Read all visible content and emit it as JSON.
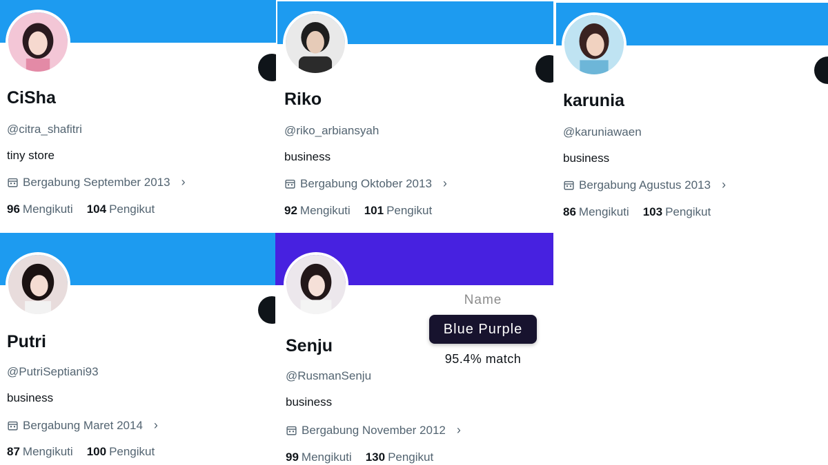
{
  "colors": {
    "twitter_blue": "#1d9bf0",
    "blue_purple": "#4721e0",
    "text": "#0f1419",
    "muted": "#536471"
  },
  "profiles": [
    {
      "name": "CiSha",
      "handle": "@citra_shafitri",
      "bio": "tiny store",
      "joined": "Bergabung September 2013",
      "following_count": "96",
      "following_label": "Mengikuti",
      "followers_count": "104",
      "followers_label": "Pengikut"
    },
    {
      "name": "Riko",
      "handle": "@riko_arbiansyah",
      "bio": "business",
      "joined": "Bergabung Oktober 2013",
      "following_count": "92",
      "following_label": "Mengikuti",
      "followers_count": "101",
      "followers_label": "Pengikut"
    },
    {
      "name": "karunia",
      "handle": "@karuniawaen",
      "bio": "business",
      "joined": "Bergabung Agustus 2013",
      "following_count": "86",
      "following_label": "Mengikuti",
      "followers_count": "103",
      "followers_label": "Pengikut"
    },
    {
      "name": "Putri",
      "handle": "@PutriSeptiani93",
      "bio": "business",
      "joined": "Bergabung Maret 2014",
      "following_count": "87",
      "following_label": "Mengikuti",
      "followers_count": "100",
      "followers_label": "Pengikut"
    },
    {
      "name": "Senju",
      "handle": "@RusmanSenju",
      "bio": "business",
      "joined": "Bergabung November 2012",
      "following_count": "99",
      "following_label": "Mengikuti",
      "followers_count": "130",
      "followers_label": "Pengikut"
    }
  ],
  "icons": {
    "calendar": "calendar-icon",
    "chevron": "chevron-right-icon",
    "chevron_glyph": "›"
  },
  "color_match": {
    "label": "Name",
    "color_name": "Blue Purple",
    "match": "95.4% match"
  }
}
